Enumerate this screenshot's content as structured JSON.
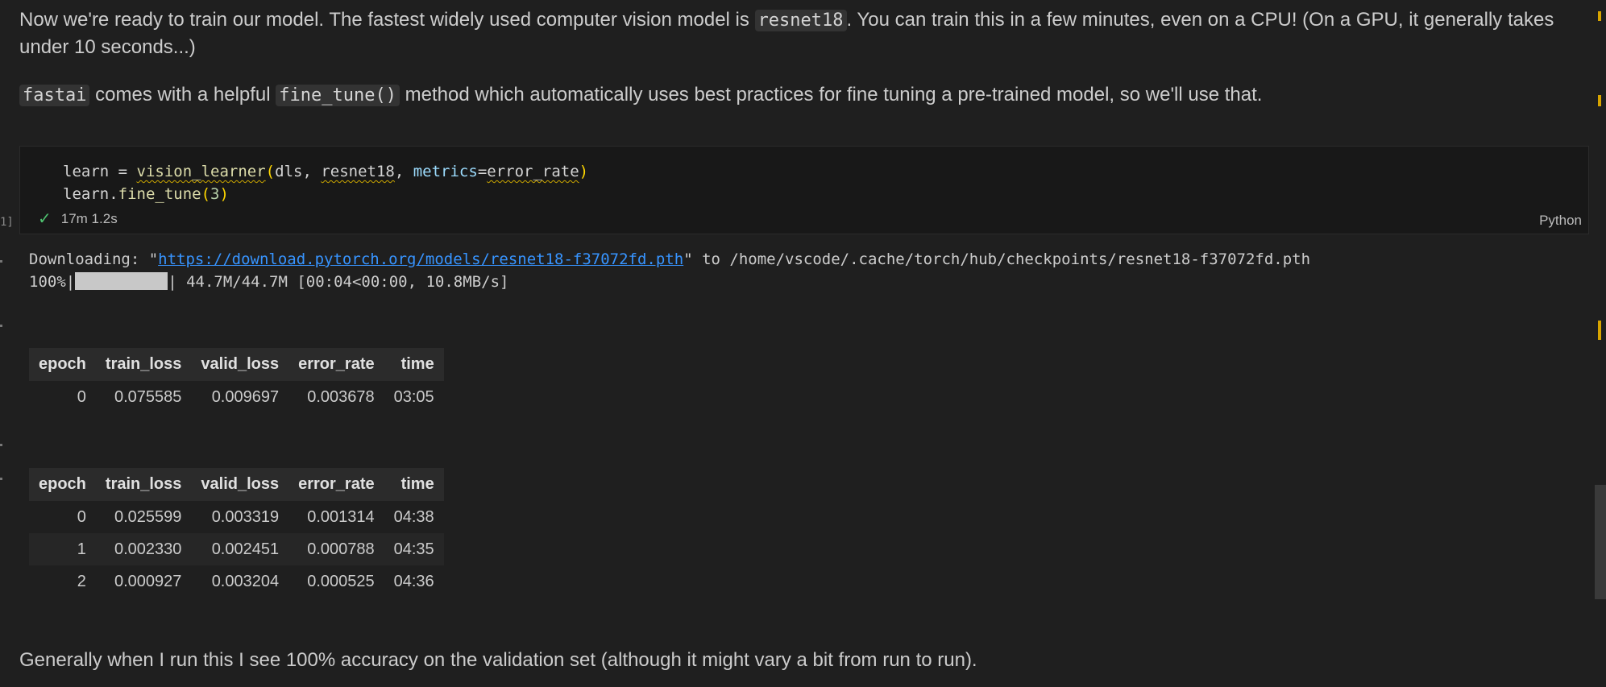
{
  "markdown": {
    "p1_a": "Now we're ready to train our model. The fastest widely used computer vision model is ",
    "p1_code": "resnet18",
    "p1_b": ". You can train this in a few minutes, even on a CPU! (On a GPU, it generally takes under 10 seconds...)",
    "p2_code1": "fastai",
    "p2_a": " comes with a helpful ",
    "p2_code2": "fine_tune()",
    "p2_b": " method which automatically uses best practices for fine tuning a pre-trained model, so we'll use that.",
    "p3": "Generally when I run this I see 100% accuracy on the validation set (although it might vary a bit from run to run)."
  },
  "cell": {
    "code_line1": {
      "t1": "learn = ",
      "fn": "vision_learner",
      "p_open": "(",
      "t2": "dls, ",
      "arch": "resnet18",
      "t3": ", ",
      "param": "metrics",
      "eq": "=",
      "metric": "error_rate",
      "p_close": ")"
    },
    "code_line2": {
      "t1": "learn.",
      "fn": "fine_tune",
      "p_open": "(",
      "num": "3",
      "p_close": ")"
    },
    "exec_count": "1]",
    "status_time": "17m 1.2s",
    "language": "Python"
  },
  "output": {
    "download_prefix": "Downloading: \"",
    "download_url": "https://download.pytorch.org/models/resnet18-f37072fd.pth",
    "download_suffix": "\" to /home/vscode/.cache/torch/hub/checkpoints/resnet18-f37072fd.pth",
    "progress_pct": "100%|",
    "progress_fraction": 1.0,
    "progress_rest": "| 44.7M/44.7M [00:04<00:00, 10.8MB/s]",
    "headers": [
      "epoch",
      "train_loss",
      "valid_loss",
      "error_rate",
      "time"
    ],
    "table1": [
      [
        "0",
        "0.075585",
        "0.009697",
        "0.003678",
        "03:05"
      ]
    ],
    "table2": [
      [
        "0",
        "0.025599",
        "0.003319",
        "0.001314",
        "04:38"
      ],
      [
        "1",
        "0.002330",
        "0.002451",
        "0.000788",
        "04:35"
      ],
      [
        "2",
        "0.000927",
        "0.003204",
        "0.000525",
        "04:36"
      ]
    ]
  },
  "icons": {
    "status": "check-icon"
  },
  "colors": {
    "background": "#1f1f1f",
    "link": "#3794ff",
    "success": "#4ec06f"
  }
}
